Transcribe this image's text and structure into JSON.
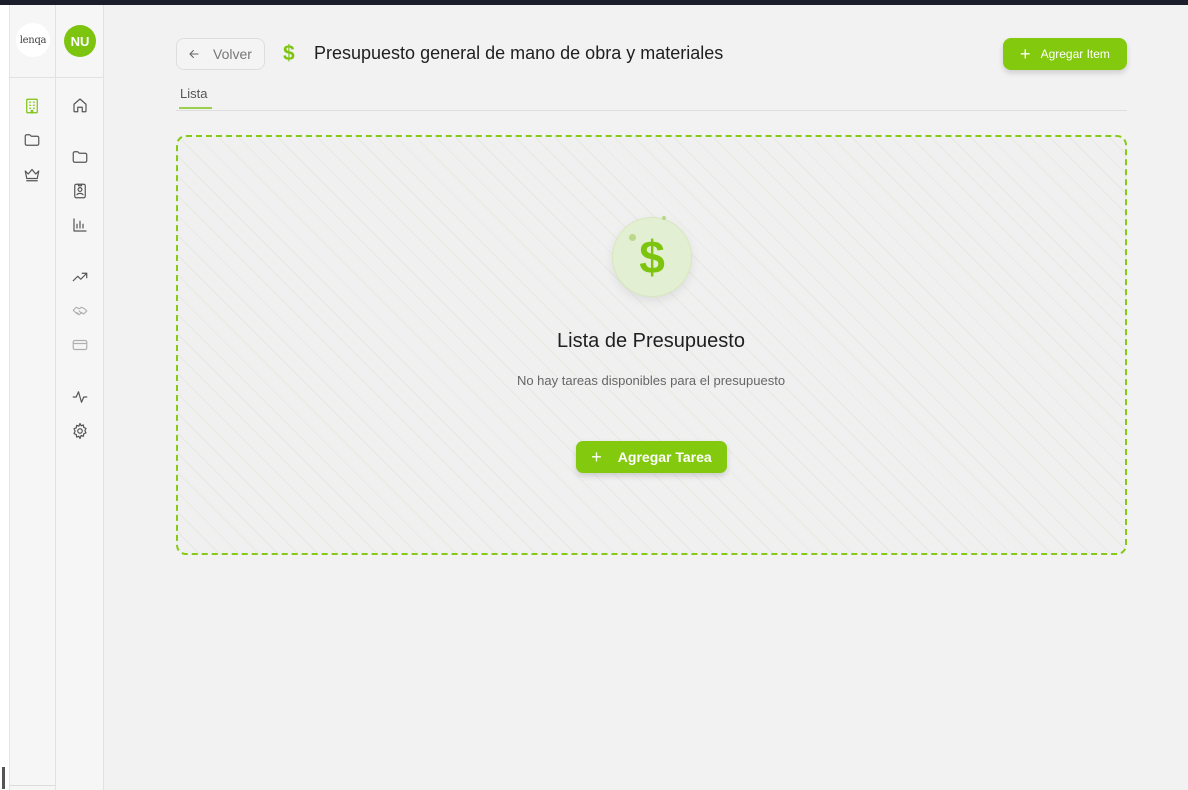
{
  "app": {
    "logo_text": "lenqa",
    "user_initials": "NU",
    "accent_color": "#83c90e"
  },
  "rail1": {
    "items": [
      {
        "icon": "building-icon",
        "active": true
      },
      {
        "icon": "folder-icon",
        "active": false
      },
      {
        "icon": "crown-icon",
        "active": false
      }
    ]
  },
  "rail2": {
    "items": [
      {
        "icon": "home-icon"
      },
      {
        "icon": "folder-icon"
      },
      {
        "icon": "contact-card-icon"
      },
      {
        "icon": "bar-chart-icon"
      },
      {
        "icon": "trending-up-icon"
      },
      {
        "icon": "handshake-icon"
      },
      {
        "icon": "credit-card-icon"
      },
      {
        "icon": "activity-icon"
      },
      {
        "icon": "settings-gear-icon"
      }
    ]
  },
  "header": {
    "back_label": "Volver",
    "title_icon": "$",
    "title": "Presupuesto general de mano de obra y materiales",
    "add_item_label": "Agregar Item"
  },
  "tabs": [
    {
      "label": "Lista",
      "active": true
    }
  ],
  "empty_state": {
    "icon": "$",
    "title": "Lista de Presupuesto",
    "subtitle": "No hay tareas disponibles para el presupuesto",
    "action_label": "Agregar Tarea"
  }
}
